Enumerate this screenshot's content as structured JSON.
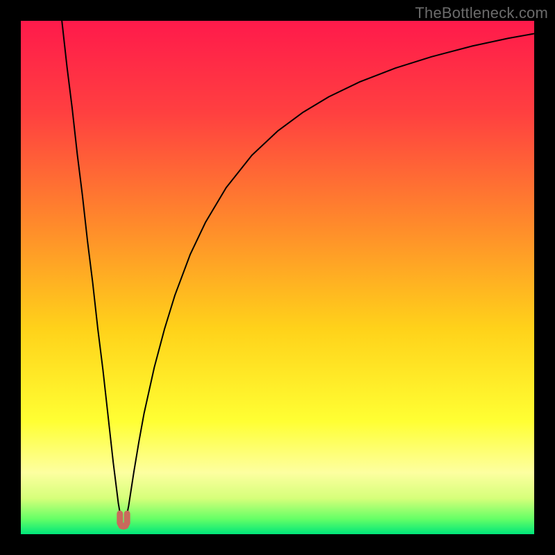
{
  "watermark": "TheBottleneck.com",
  "chart_data": {
    "type": "line",
    "title": "",
    "xlabel": "",
    "ylabel": "",
    "xlim": [
      0,
      100
    ],
    "ylim": [
      0,
      100
    ],
    "grid": false,
    "legend": false,
    "background_gradient_stops": [
      {
        "offset": 0.0,
        "color": "#ff1a4b"
      },
      {
        "offset": 0.18,
        "color": "#ff4040"
      },
      {
        "offset": 0.4,
        "color": "#ff8b2b"
      },
      {
        "offset": 0.6,
        "color": "#ffd21a"
      },
      {
        "offset": 0.78,
        "color": "#ffff33"
      },
      {
        "offset": 0.88,
        "color": "#fdffa0"
      },
      {
        "offset": 0.93,
        "color": "#d6ff7a"
      },
      {
        "offset": 0.97,
        "color": "#66ff66"
      },
      {
        "offset": 1.0,
        "color": "#00e67a"
      }
    ],
    "series": [
      {
        "name": "bottleneck-curve",
        "color": "#000000",
        "stroke_width": 2,
        "x": [
          8.0,
          9.0,
          10.0,
          11.0,
          12.0,
          13.0,
          14.0,
          15.0,
          16.0,
          17.0,
          18.0,
          19.0,
          19.6,
          20.0,
          20.4,
          21.0,
          22.0,
          23.0,
          24.0,
          26.0,
          28.0,
          30.0,
          33.0,
          36.0,
          40.0,
          45.0,
          50.0,
          55.0,
          60.0,
          66.0,
          73.0,
          80.0,
          88.0,
          95.0,
          100.0
        ],
        "y": [
          100.0,
          91.0,
          83.0,
          74.0,
          66.0,
          57.0,
          49.0,
          40.0,
          32.0,
          23.0,
          14.0,
          6.0,
          2.5,
          1.8,
          2.5,
          5.5,
          12.0,
          18.0,
          23.5,
          32.5,
          40.0,
          46.5,
          54.5,
          60.8,
          67.5,
          73.8,
          78.5,
          82.2,
          85.2,
          88.1,
          90.8,
          93.0,
          95.1,
          96.6,
          97.5
        ]
      }
    ],
    "marker": {
      "name": "u-marker",
      "color": "#c96a5c",
      "stroke_width": 9,
      "x": [
        19.3,
        19.3,
        19.6,
        20.0,
        20.4,
        20.7,
        20.7
      ],
      "y": [
        4.0,
        2.2,
        1.6,
        1.5,
        1.6,
        2.2,
        4.0
      ]
    }
  }
}
